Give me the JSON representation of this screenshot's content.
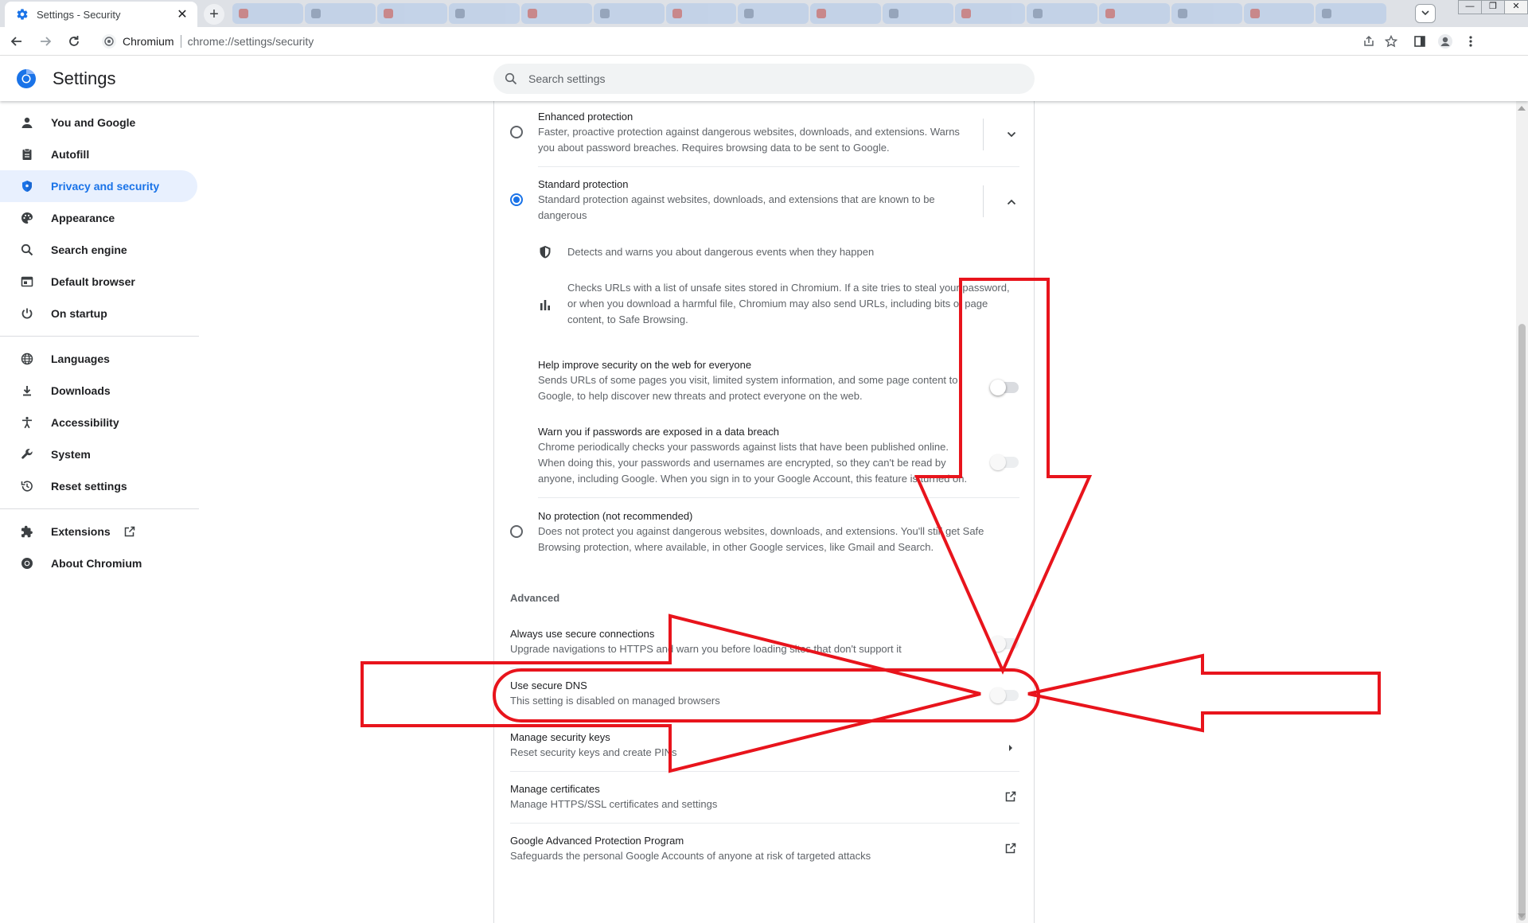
{
  "browser": {
    "active_tab_title": "Settings - Security",
    "new_tab_label": "+",
    "close_tab_label": "✕",
    "background_tab_count": 16,
    "omnibox_site": "Chromium",
    "omnibox_url": "chrome://settings/security",
    "window_min": "—",
    "window_max": "❐",
    "window_close": "✕"
  },
  "header": {
    "title": "Settings",
    "search_placeholder": "Search settings"
  },
  "sidebar": {
    "items": [
      {
        "label": "You and Google",
        "icon": "person-icon"
      },
      {
        "label": "Autofill",
        "icon": "clipboard-icon"
      },
      {
        "label": "Privacy and security",
        "icon": "shield-icon",
        "active": true
      },
      {
        "label": "Appearance",
        "icon": "palette-icon"
      },
      {
        "label": "Search engine",
        "icon": "search-icon"
      },
      {
        "label": "Default browser",
        "icon": "browser-window-icon"
      },
      {
        "label": "On startup",
        "icon": "power-icon"
      },
      {
        "label": "Languages",
        "icon": "globe-icon"
      },
      {
        "label": "Downloads",
        "icon": "download-icon"
      },
      {
        "label": "Accessibility",
        "icon": "accessibility-icon"
      },
      {
        "label": "System",
        "icon": "wrench-icon"
      },
      {
        "label": "Reset settings",
        "icon": "history-icon"
      },
      {
        "label": "Extensions",
        "icon": "puzzle-icon"
      },
      {
        "label": "About Chromium",
        "icon": "chromium-icon"
      }
    ]
  },
  "main": {
    "enhanced": {
      "title": "Enhanced protection",
      "desc1": "Faster, proactive protection against dangerous websites, downloads, and extensions. Warns",
      "desc2": "you about password breaches. Requires browsing data to be sent to Google.",
      "checked": false
    },
    "standard": {
      "title": "Standard protection",
      "desc1": "Standard protection against websites, downloads, and extensions that are known to be",
      "desc2": "dangerous",
      "checked": true,
      "detail1": "Detects and warns you about dangerous events when they happen",
      "detail2_l1": "Checks URLs with a list of unsafe sites stored in Chromium. If a site tries to steal your password,",
      "detail2_l2": "or when you download a harmful file, Chromium may also send URLs, including bits of page",
      "detail2_l3": "content, to Safe Browsing."
    },
    "help_improve": {
      "title": "Help improve security on the web for everyone",
      "desc1": "Sends URLs of some pages you visit, limited system information, and some page content to",
      "desc2": "Google, to help discover new threats and protect everyone on the web.",
      "enabled": false
    },
    "password_warn": {
      "title": "Warn you if passwords are exposed in a data breach",
      "desc1": "Chrome periodically checks your passwords against lists that have been published online.",
      "desc2": "When doing this, your passwords and usernames are encrypted, so they can't be read by",
      "desc3": "anyone, including Google. When you sign in to your Google Account, this feature is turned on.",
      "enabled": false
    },
    "no_protection": {
      "title": "No protection (not recommended)",
      "desc1": "Does not protect you against dangerous websites, downloads, and extensions. You'll still get Safe",
      "desc2": "Browsing protection, where available, in other Google services, like Gmail and Search.",
      "checked": false
    },
    "advanced_label": "Advanced",
    "secure_connections": {
      "title": "Always use secure connections",
      "desc": "Upgrade navigations to HTTPS and warn you before loading sites that don't support it",
      "enabled": false
    },
    "secure_dns": {
      "title": "Use secure DNS",
      "desc": "This setting is disabled on managed browsers",
      "enabled": false
    },
    "security_keys": {
      "title": "Manage security keys",
      "desc": "Reset security keys and create PINs"
    },
    "certificates": {
      "title": "Manage certificates",
      "desc": "Manage HTTPS/SSL certificates and settings"
    },
    "advanced_protection": {
      "title": "Google Advanced Protection Program",
      "desc": "Safeguards the personal Google Accounts of anyone at risk of targeted attacks"
    }
  },
  "colors": {
    "accent": "#1a73e8",
    "annotation": "#e8141c",
    "active_nav_bg": "#e8f0fe"
  }
}
